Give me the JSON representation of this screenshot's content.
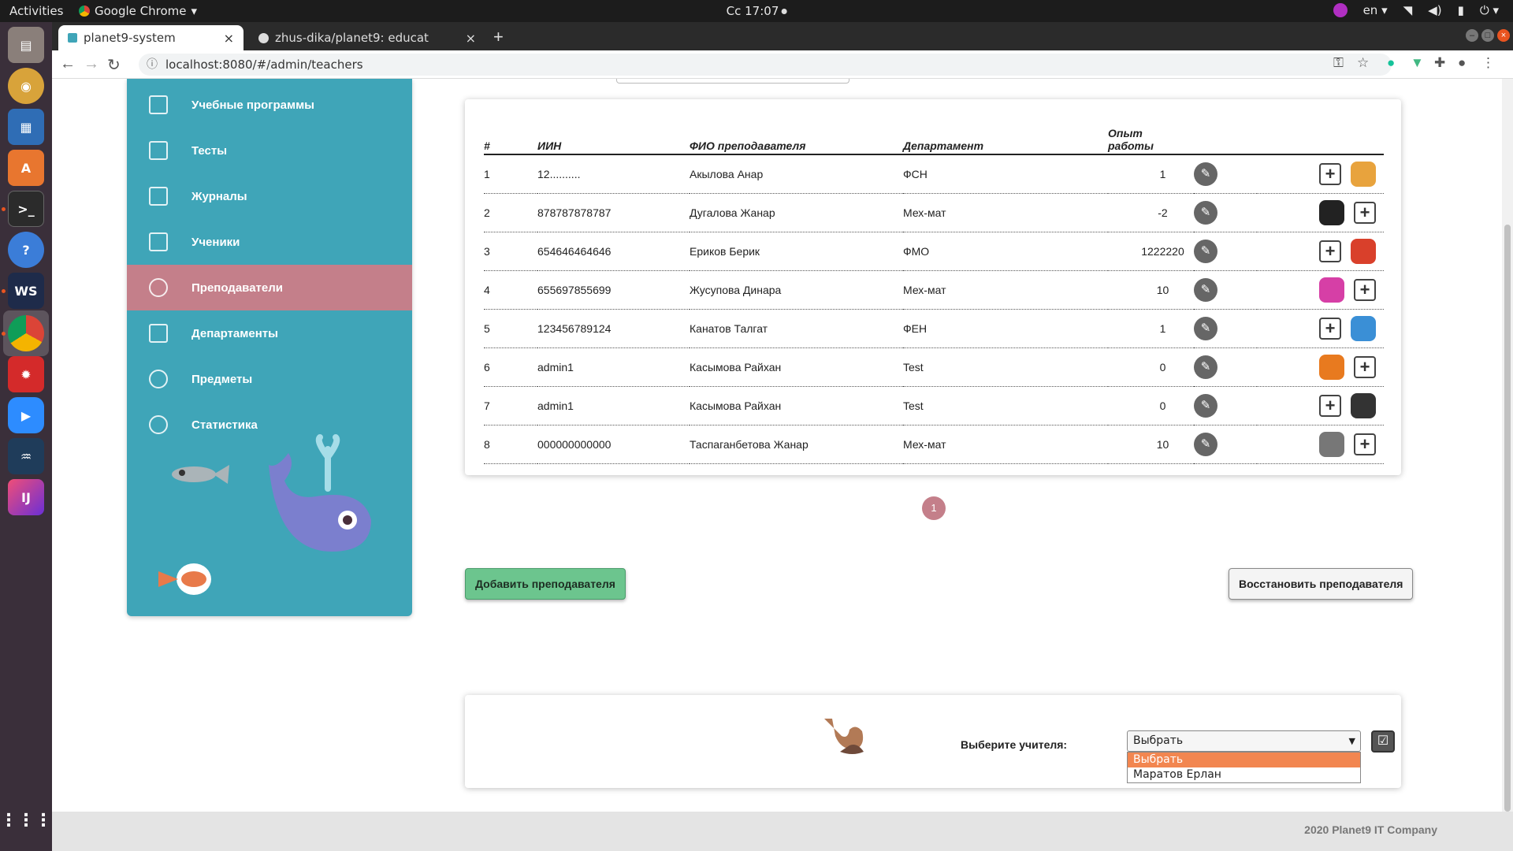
{
  "system_bar": {
    "activities": "Activities",
    "app_name": "Google Chrome",
    "clock": "Сс 17:07",
    "language": "en"
  },
  "browser": {
    "tabs": [
      {
        "label": "planet9-system"
      },
      {
        "label": "zhus-dika/planet9: educat"
      }
    ],
    "url": "localhost:8080/#/admin/teachers"
  },
  "sidebar": {
    "items": [
      {
        "label": "Учебные программы",
        "icon": "document-icon"
      },
      {
        "label": "Тесты",
        "icon": "test-list-icon"
      },
      {
        "label": "Журналы",
        "icon": "journal-icon"
      },
      {
        "label": "Ученики",
        "icon": "students-icon"
      },
      {
        "label": "Преподаватели",
        "icon": "teacher-icon",
        "active": true
      },
      {
        "label": "Департаменты",
        "icon": "department-icon"
      },
      {
        "label": "Предметы",
        "icon": "atom-icon"
      },
      {
        "label": "Статистика",
        "icon": "pie-chart-icon"
      }
    ]
  },
  "table": {
    "headers": {
      "num": "#",
      "iin": "ИИН",
      "name": "ФИО преподавателя",
      "department": "Департамент",
      "experience_line1": "Опыт",
      "experience_line2": "работы"
    },
    "rows": [
      {
        "num": "1",
        "iin": "12..........",
        "name": "Акылова Анар",
        "department": "ФСН",
        "experience": "1",
        "animal": "owl",
        "animal_color": "#e8a33d",
        "order": "plus-first"
      },
      {
        "num": "2",
        "iin": "878787878787",
        "name": "Дугалова Жанар",
        "department": "Мех-мат",
        "experience": "-2",
        "animal": "cat",
        "animal_color": "#222222",
        "order": "animal-first"
      },
      {
        "num": "3",
        "iin": "654646464646",
        "name": "Ериков Берик",
        "department": "ФМО",
        "experience": "1222220",
        "animal": "kangaroo",
        "animal_color": "#d9402b",
        "order": "plus-first"
      },
      {
        "num": "4",
        "iin": "655697855699",
        "name": "Жусупова Динара",
        "department": "Мех-мат",
        "experience": "10",
        "animal": "hippo",
        "animal_color": "#d63fa6",
        "order": "animal-first"
      },
      {
        "num": "5",
        "iin": "123456789124",
        "name": "Канатов Талгат",
        "department": "ФЕН",
        "experience": "1",
        "animal": "butterfly",
        "animal_color": "#3a8fd6",
        "order": "plus-first"
      },
      {
        "num": "6",
        "iin": "admin1",
        "name": "Касымова Райхан",
        "department": "Test",
        "experience": "0",
        "animal": "lion",
        "animal_color": "#e87a1f",
        "order": "animal-first"
      },
      {
        "num": "7",
        "iin": "admin1",
        "name": "Касымова Райхан",
        "department": "Test",
        "experience": "0",
        "animal": "penguin",
        "animal_color": "#333333",
        "order": "plus-first"
      },
      {
        "num": "8",
        "iin": "000000000000",
        "name": "Таспаганбетова Жанар",
        "department": "Мех-мат",
        "experience": "10",
        "animal": "dog",
        "animal_color": "#777777",
        "order": "animal-first"
      }
    ]
  },
  "pagination": {
    "current": "1"
  },
  "buttons": {
    "add_teacher": "Добавить преподавателя",
    "restore_teacher": "Восстановить преподавателя"
  },
  "teacher_select": {
    "label": "Выберите учителя:",
    "value": "Выбрать",
    "options": [
      "Выбрать",
      "Маратов Ерлан"
    ]
  },
  "footer": {
    "text": "2020 Planet9 IT Company"
  },
  "colors": {
    "sidebar": "#3fa5b8",
    "sidebar_active": "#c47f8a",
    "add_button": "#6cc58e",
    "dropdown_highlight": "#f28650"
  }
}
